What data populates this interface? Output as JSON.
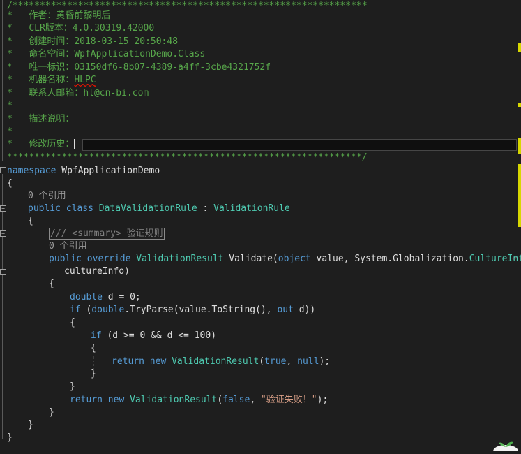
{
  "editor": {
    "header": {
      "top_border": "/*****************************************************************",
      "author_label": "作者：",
      "author": "黄昏前黎明后",
      "clr_label": "CLR版本：",
      "clr": "4.0.30319.42000",
      "created_label": "创建时间：",
      "created": "2018-03-15 20:50:48",
      "namespace_label": "命名空间：",
      "namespace": "WpfApplicationDemo.Class",
      "uid_label": "唯一标识：",
      "uid": "03150df6-8b07-4389-a4ff-3cbe4321752f",
      "machine_label": "机器名称：",
      "machine": "HLPC",
      "email_label": "联系人邮箱：",
      "email": "hl@cn-bi.com",
      "desc_label": "描述说明：",
      "history_label": "修改历史：",
      "bottom_border": "*****************************************************************/"
    },
    "code": {
      "kw_namespace": "namespace",
      "ns_name": " WpfApplicationDemo",
      "refs1": "0 个引用",
      "kw_public": "public",
      "kw_class": "class",
      "class_name": "DataValidationRule",
      "colon": " : ",
      "base_class": "ValidationRule",
      "summary_text": "/// <summary> 验证规则",
      "refs2": "0 个引用",
      "kw_override": "override",
      "ret_type": "ValidationResult",
      "method_name": " Validate(",
      "kw_object": "object",
      "param1": " value, System.Globalization.",
      "culture_type": "CultureInfo",
      "param2": "cultureInfo)",
      "kw_double": "double",
      "decl": " d = 0;",
      "kw_if": "if",
      "tryparse_pre": " (",
      "tryparse_mid": ".TryParse(value.ToString(), ",
      "kw_out": "out",
      "tryparse_end": " d))",
      "cond": " (d >= 0 && d <= 100)",
      "kw_return": "return",
      "kw_new": "new",
      "kw_true": "true",
      "kw_null": "null",
      "kw_false": "false",
      "fail_msg": "\"验证失败！\"",
      "open_brace": "{",
      "close_brace": "}",
      "semicolon_end": ");",
      "comma": ", "
    }
  }
}
